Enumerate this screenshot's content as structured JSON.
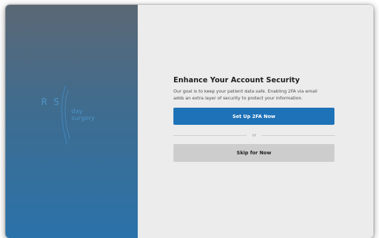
{
  "logo": {
    "letters": [
      "R",
      "S"
    ],
    "line1": "day",
    "line2": "surgery"
  },
  "main": {
    "title": "Enhance Your Account Security",
    "description_line1": "Our goal is to keep your patient data safe. Enabling 2FA via email",
    "description_line2": "adds an extra layer of security to protect your information.",
    "primary_button": "Set Up 2FA Now",
    "divider_text": "or",
    "secondary_button": "Skip for Now"
  },
  "colors": {
    "panel_top": "#5b6875",
    "panel_bottom": "#2a72aa",
    "primary": "#1e72b7",
    "secondary": "#cdcdcd",
    "background": "#ececec"
  }
}
